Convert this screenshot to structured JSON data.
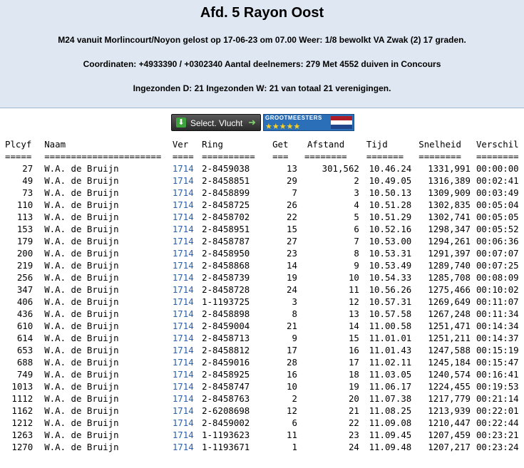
{
  "header": {
    "title": "Afd. 5 Rayon Oost",
    "line1": "M24 vanuit Morlincourt/Noyon gelost op 17-06-23 om 07.00 Weer: 1/8 bewolkt VA Zwak (2) 17 graden.",
    "line2": "Coordinaten: +4933390 / +0302340 Aantal deelnemers: 279 Met 4552 duiven in Concours",
    "line3": "Ingezonden D: 21 Ingezonden W: 21 van totaal 21 verenigingen."
  },
  "toolbar": {
    "select_label": "Select. Vlucht",
    "badge_text": "GROOTMEESTERS",
    "badge_stars": "★★★★★"
  },
  "table": {
    "columns": [
      "Plcyf",
      "Naam",
      "Ver",
      "Ring",
      "Get",
      "Afstand",
      "Tijd",
      "Snelheid",
      "Verschil"
    ],
    "underlines": [
      "=====",
      "======================",
      "====",
      "==========",
      "===",
      "========",
      "=======",
      "========",
      "========"
    ],
    "rows": [
      [
        "27",
        "W.A. de Bruijn",
        "1714",
        "2-8459038",
        "13",
        "301,562",
        "10.46.24",
        "1331,991",
        "00:00:00"
      ],
      [
        "49",
        "W.A. de Bruijn",
        "1714",
        "2-8458851",
        "29",
        "2",
        "10.49.05",
        "1316,389",
        "00:02:41"
      ],
      [
        "73",
        "W.A. de Bruijn",
        "1714",
        "2-8458899",
        "7",
        "3",
        "10.50.13",
        "1309,909",
        "00:03:49"
      ],
      [
        "110",
        "W.A. de Bruijn",
        "1714",
        "2-8458725",
        "26",
        "4",
        "10.51.28",
        "1302,835",
        "00:05:04"
      ],
      [
        "113",
        "W.A. de Bruijn",
        "1714",
        "2-8458702",
        "22",
        "5",
        "10.51.29",
        "1302,741",
        "00:05:05"
      ],
      [
        "153",
        "W.A. de Bruijn",
        "1714",
        "2-8458951",
        "15",
        "6",
        "10.52.16",
        "1298,347",
        "00:05:52"
      ],
      [
        "179",
        "W.A. de Bruijn",
        "1714",
        "2-8458787",
        "27",
        "7",
        "10.53.00",
        "1294,261",
        "00:06:36"
      ],
      [
        "200",
        "W.A. de Bruijn",
        "1714",
        "2-8458950",
        "23",
        "8",
        "10.53.31",
        "1291,397",
        "00:07:07"
      ],
      [
        "219",
        "W.A. de Bruijn",
        "1714",
        "2-8458868",
        "14",
        "9",
        "10.53.49",
        "1289,740",
        "00:07:25"
      ],
      [
        "256",
        "W.A. de Bruijn",
        "1714",
        "2-8458739",
        "19",
        "10",
        "10.54.33",
        "1285,708",
        "00:08:09"
      ],
      [
        "347",
        "W.A. de Bruijn",
        "1714",
        "2-8458728",
        "24",
        "11",
        "10.56.26",
        "1275,466",
        "00:10:02"
      ],
      [
        "406",
        "W.A. de Bruijn",
        "1714",
        "1-1193725",
        "3",
        "12",
        "10.57.31",
        "1269,649",
        "00:11:07"
      ],
      [
        "436",
        "W.A. de Bruijn",
        "1714",
        "2-8458898",
        "8",
        "13",
        "10.57.58",
        "1267,248",
        "00:11:34"
      ],
      [
        "610",
        "W.A. de Bruijn",
        "1714",
        "2-8459004",
        "21",
        "14",
        "11.00.58",
        "1251,471",
        "00:14:34"
      ],
      [
        "614",
        "W.A. de Bruijn",
        "1714",
        "2-8458713",
        "9",
        "15",
        "11.01.01",
        "1251,211",
        "00:14:37"
      ],
      [
        "653",
        "W.A. de Bruijn",
        "1714",
        "2-8458812",
        "17",
        "16",
        "11.01.43",
        "1247,588",
        "00:15:19"
      ],
      [
        "688",
        "W.A. de Bruijn",
        "1714",
        "2-8459016",
        "28",
        "17",
        "11.02.11",
        "1245,184",
        "00:15:47"
      ],
      [
        "749",
        "W.A. de Bruijn",
        "1714",
        "2-8458925",
        "16",
        "18",
        "11.03.05",
        "1240,574",
        "00:16:41"
      ],
      [
        "1013",
        "W.A. de Bruijn",
        "1714",
        "2-8458747",
        "10",
        "19",
        "11.06.17",
        "1224,455",
        "00:19:53"
      ],
      [
        "1112",
        "W.A. de Bruijn",
        "1714",
        "2-8458763",
        "2",
        "20",
        "11.07.38",
        "1217,779",
        "00:21:14"
      ],
      [
        "1162",
        "W.A. de Bruijn",
        "1714",
        "2-6208698",
        "12",
        "21",
        "11.08.25",
        "1213,939",
        "00:22:01"
      ],
      [
        "1212",
        "W.A. de Bruijn",
        "1714",
        "2-8459002",
        "6",
        "22",
        "11.09.08",
        "1210,447",
        "00:22:44"
      ],
      [
        "1263",
        "W.A. de Bruijn",
        "1714",
        "1-1193623",
        "11",
        "23",
        "11.09.45",
        "1207,459",
        "00:23:21"
      ],
      [
        "1270",
        "W.A. de Bruijn",
        "1714",
        "1-1193671",
        "1",
        "24",
        "11.09.48",
        "1207,217",
        "00:23:24"
      ]
    ]
  },
  "colors": {
    "header_bg": "#dfe8f2",
    "link": "#2b5ea8",
    "flag_red": "#ae1c28",
    "flag_white": "#ffffff",
    "flag_blue": "#21468b"
  }
}
